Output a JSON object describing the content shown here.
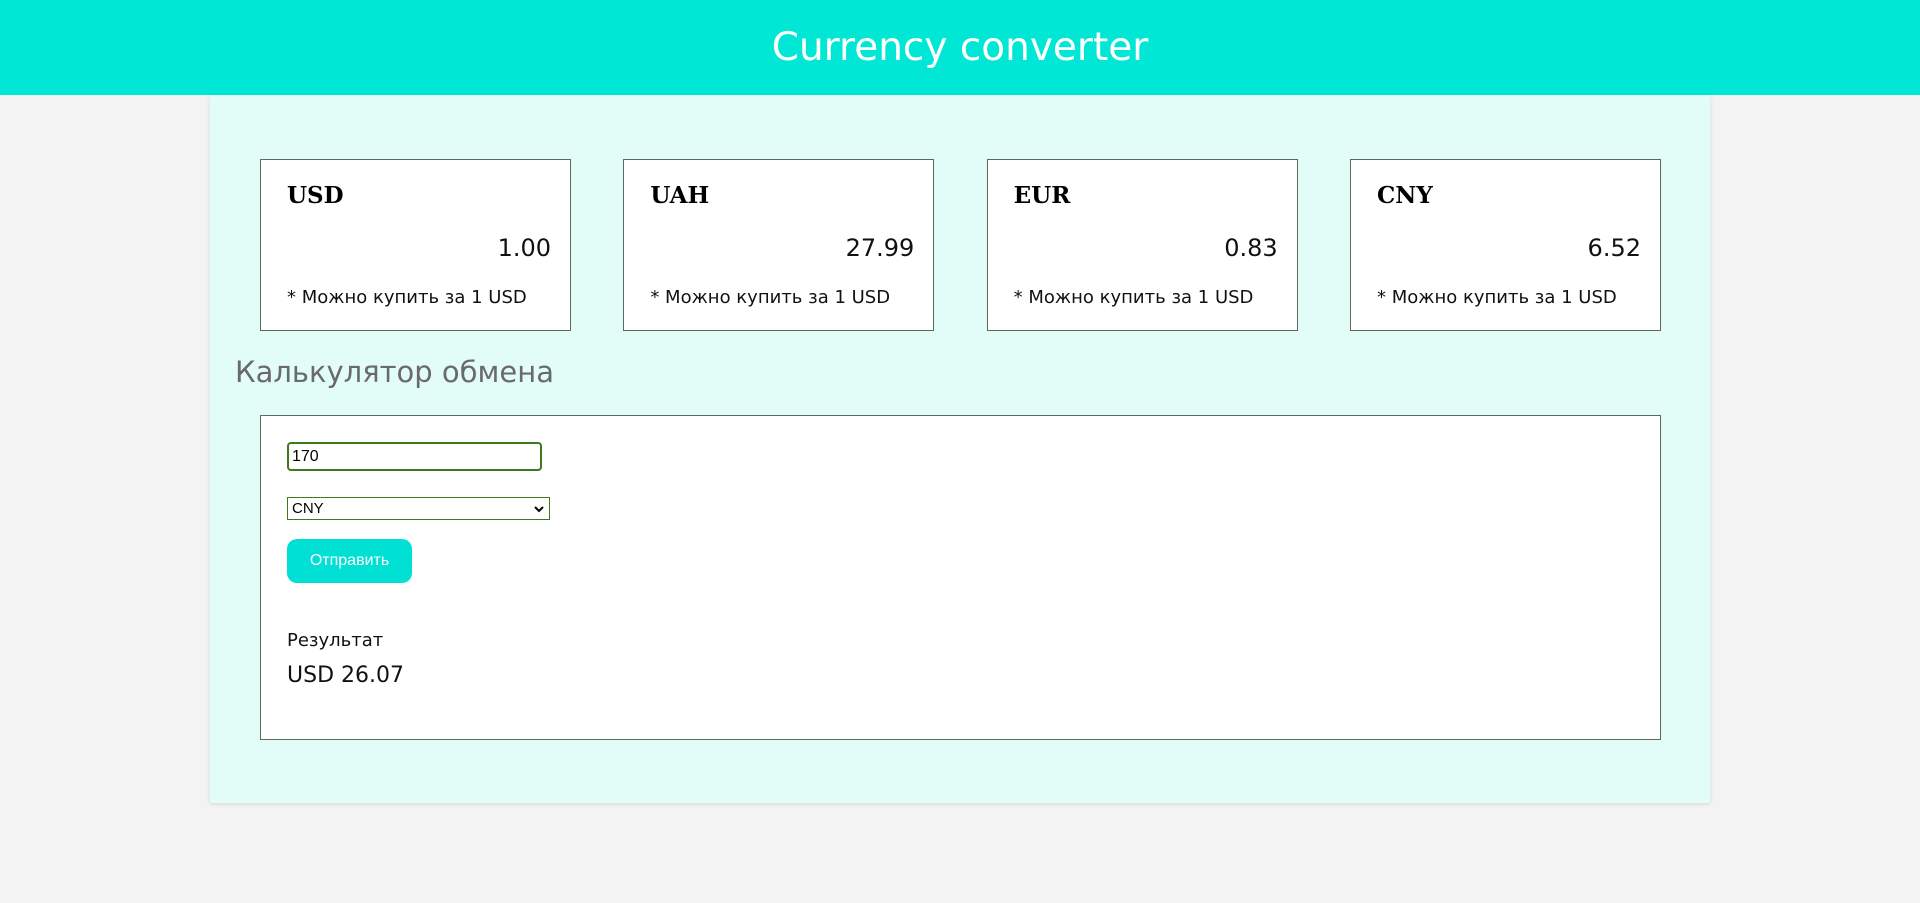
{
  "header": {
    "title": "Currency converter"
  },
  "cards": [
    {
      "code": "USD",
      "rate": "1.00",
      "note": "* Можно купить за 1 USD"
    },
    {
      "code": "UAH",
      "rate": "27.99",
      "note": "* Можно купить за 1 USD"
    },
    {
      "code": "EUR",
      "rate": "0.83",
      "note": "* Можно купить за 1 USD"
    },
    {
      "code": "CNY",
      "rate": "6.52",
      "note": "* Можно купить за 1 USD"
    }
  ],
  "calculator": {
    "title": "Калькулятор обмена",
    "amount_value": "170",
    "selected_currency": "CNY",
    "submit_label": "Отправить",
    "result_label": "Результат",
    "result_value": "USD 26.07"
  },
  "colors": {
    "header_bg": "#00e8d5",
    "accent": "#00e0d4",
    "panel_bg": "#e2fdf8",
    "border": "#5c6b57",
    "input_border": "#3d7a1e"
  },
  "icons": {
    "select_chevron": "chevron-down-icon"
  }
}
